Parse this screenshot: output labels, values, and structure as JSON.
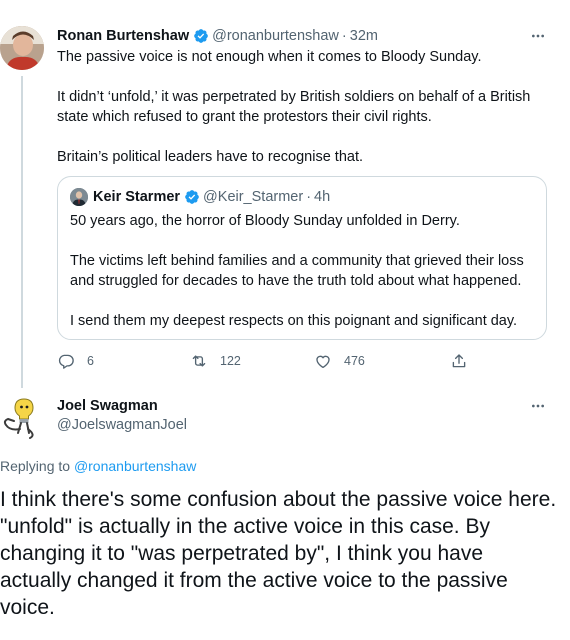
{
  "colors": {
    "accent": "#1d9bf0",
    "secondary_text": "#536471",
    "border": "#cfd9de"
  },
  "tweet": {
    "author_name": "Ronan Burtenshaw",
    "handle": "@ronanburtenshaw",
    "separator": "·",
    "time": "32m",
    "paragraphs": [
      "The passive voice is not enough when it comes to Bloody Sunday.",
      "It didn’t ‘unfold,’ it was perpetrated by British soldiers on behalf of a British state which refused to grant the protestors their civil rights.",
      "Britain’s political leaders have to recognise that."
    ],
    "quote": {
      "author_name": "Keir Starmer",
      "handle": "@Keir_Starmer",
      "separator": "·",
      "time": "4h",
      "paragraphs": [
        "50 years ago, the horror of Bloody Sunday unfolded in Derry.",
        "The victims left behind families and a community that grieved their loss and struggled for decades to have the truth told about what happened.",
        "I send them my deepest respects on this poignant and significant day."
      ]
    },
    "actions": {
      "replies": "6",
      "retweets": "122",
      "likes": "476"
    },
    "icons": [
      "verified-badge-icon",
      "more-icon",
      "reply-icon",
      "retweet-icon",
      "like-icon",
      "share-icon"
    ]
  },
  "reply": {
    "author_name": "Joel Swagman",
    "handle": "@JoelswagmanJoel",
    "replying_prefix": "Replying to",
    "replying_to": "@ronanburtenshaw",
    "text": "I think there's some confusion about the passive voice here.  \"unfold\" is  actually in the active voice in this case.  By changing it to \"was perpetrated by\", I think you have actually changed it from the active voice to the passive voice."
  }
}
